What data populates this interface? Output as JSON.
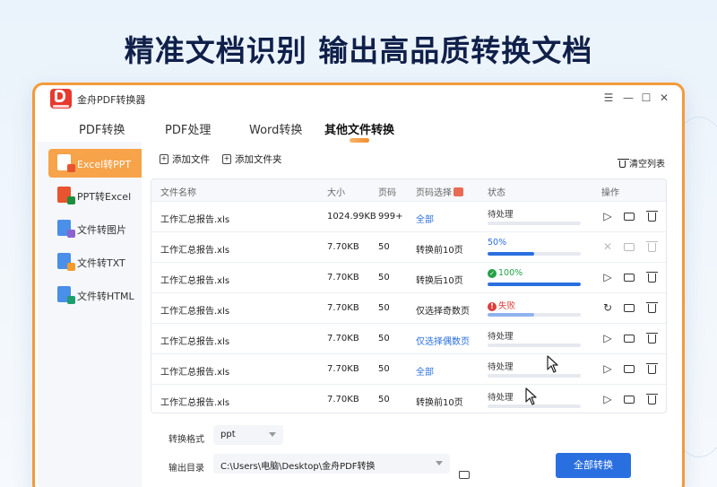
{
  "banner": "精准文档识别 输出高品质转换文档",
  "app": {
    "title": "金舟PDF转换器",
    "logo_icon": "pdf-logo-icon",
    "window_controls": [
      "☰",
      "—",
      "☐",
      "✕"
    ]
  },
  "tabs": [
    {
      "label": "PDF转换",
      "active": false
    },
    {
      "label": "PDF处理",
      "active": false
    },
    {
      "label": "Word转换",
      "active": false
    },
    {
      "label": "其他文件转换",
      "active": true
    }
  ],
  "sidebar": {
    "items": [
      {
        "label": "Excel转PPT",
        "active": true,
        "color": "#1e8e3e",
        "badge": "#e8542f"
      },
      {
        "label": "PPT转Excel",
        "active": false,
        "color": "#e8542f",
        "badge": "#1e8e3e"
      },
      {
        "label": "文件转图片",
        "active": false,
        "color": "#4a8fe8",
        "badge": "#8a63d2"
      },
      {
        "label": "文件转TXT",
        "active": false,
        "color": "#4a8fe8",
        "badge": "#f39a2d"
      },
      {
        "label": "文件转HTML",
        "active": false,
        "color": "#4a8fe8",
        "badge": "#1e9e6e"
      }
    ]
  },
  "toolbar": {
    "add_file": "添加文件",
    "add_folder": "添加文件夹",
    "clear_list": "清空列表"
  },
  "table": {
    "columns": [
      "文件名称",
      "大小",
      "页码",
      "页码选择",
      "状态",
      "操作"
    ],
    "rows": [
      {
        "name": "工作汇总报告.xls",
        "size": "1024.99KB",
        "pages": "999+",
        "page_select": "全部",
        "link": true,
        "status": "待处理",
        "status_kind": "pending",
        "progress": 0,
        "action": "play"
      },
      {
        "name": "工作汇总报告.xls",
        "size": "7.70KB",
        "pages": "50",
        "page_select": "转换前10页",
        "link": false,
        "status": "50%",
        "status_kind": "percent",
        "progress": 0.5,
        "action": "cancel"
      },
      {
        "name": "工作汇总报告.xls",
        "size": "7.70KB",
        "pages": "50",
        "page_select": "转换后10页",
        "link": false,
        "status": "100%",
        "status_kind": "ok",
        "progress": 1.0,
        "action": "play"
      },
      {
        "name": "工作汇总报告.xls",
        "size": "7.70KB",
        "pages": "50",
        "page_select": "仅选择奇数页",
        "link": false,
        "status": "失败",
        "status_kind": "fail",
        "progress": 0.5,
        "action": "retry"
      },
      {
        "name": "工作汇总报告.xls",
        "size": "7.70KB",
        "pages": "50",
        "page_select": "仅选择偶数页",
        "link": true,
        "status": "待处理",
        "status_kind": "pending",
        "progress": 0,
        "action": "play"
      },
      {
        "name": "工作汇总报告.xls",
        "size": "7.70KB",
        "pages": "50",
        "page_select": "全部",
        "link": true,
        "status": "待处理",
        "status_kind": "pending",
        "progress": 0,
        "action": "play"
      },
      {
        "name": "工作汇总报告.xls",
        "size": "7.70KB",
        "pages": "50",
        "page_select": "转换前10页",
        "link": false,
        "status": "待处理",
        "status_kind": "pending",
        "progress": 0,
        "action": "play"
      }
    ]
  },
  "bottom": {
    "format_label": "转换格式",
    "format_value": "ppt",
    "output_label": "输出目录",
    "output_value": "C:\\Users\\电脑\\Desktop\\金舟PDF转换",
    "convert_all": "全部转换"
  },
  "colors": {
    "accent": "#f6a34a",
    "primary": "#2a6fe0",
    "success": "#24a148",
    "error": "#e03c3c"
  }
}
